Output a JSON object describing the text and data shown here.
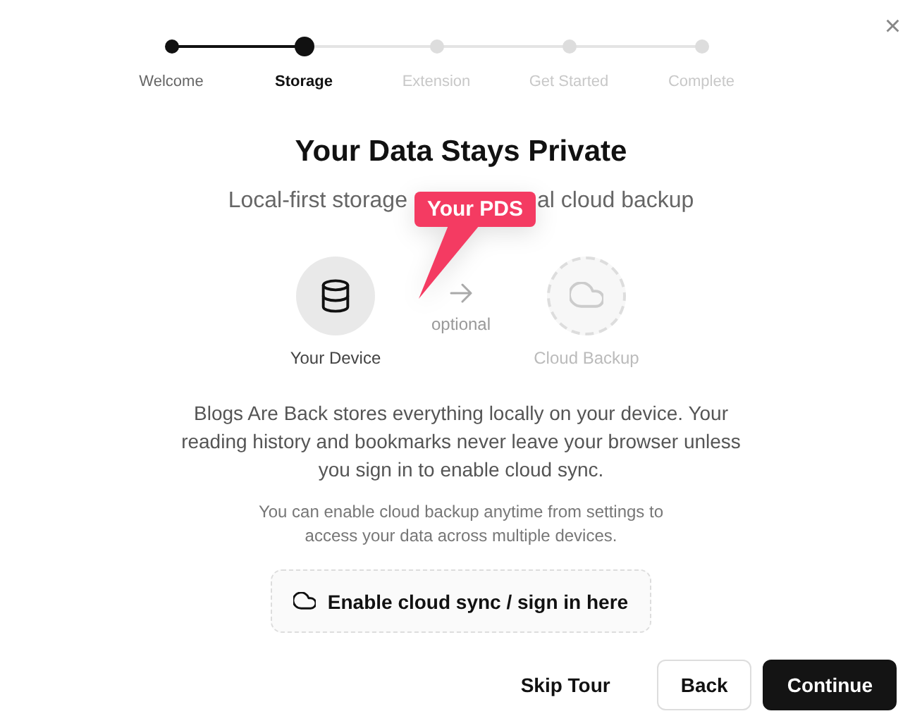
{
  "close_button": {
    "label": "×"
  },
  "steps": [
    {
      "label": "Welcome",
      "completed": true,
      "selected": false
    },
    {
      "label": "Storage",
      "completed": true,
      "selected": true
    },
    {
      "label": "Extension",
      "completed": false,
      "selected": false
    },
    {
      "label": "Get Started",
      "completed": false,
      "selected": false
    },
    {
      "label": "Complete",
      "completed": false,
      "selected": false
    }
  ],
  "title": "Your Data Stays Private",
  "subtitle_parts": [
    "Local-first storage",
    "al cloud backup"
  ],
  "callout": {
    "label": "Your PDS"
  },
  "storage_nodes": [
    {
      "kind": "device",
      "label": "Your Device",
      "enabled": true
    },
    {
      "kind": "cloud",
      "label": "Cloud Backup",
      "enabled": false
    }
  ],
  "connector_label": "optional",
  "description": "Blogs Are Back stores everything locally on your device. Your reading history and bookmarks never leave your browser unless you sign in to enable cloud sync.",
  "note": "You can enable cloud backup anytime from settings to access your data across multiple devices.",
  "sync_button": {
    "label": "Enable cloud sync / sign in here"
  },
  "footer_buttons": [
    {
      "kind": "text",
      "label": "Skip Tour"
    },
    {
      "kind": "outline",
      "label": "Back"
    },
    {
      "kind": "primary",
      "label": "Continue"
    }
  ]
}
